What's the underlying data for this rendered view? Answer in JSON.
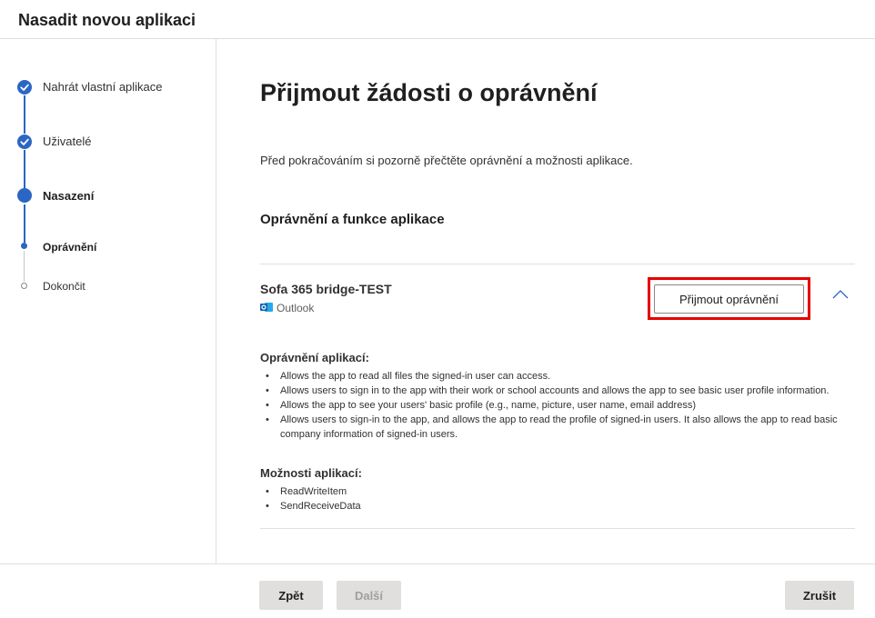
{
  "window": {
    "title": "Nasadit novou aplikaci"
  },
  "steps": [
    {
      "label": "Nahrát vlastní aplikace",
      "state": "done"
    },
    {
      "label": "Uživatelé",
      "state": "done"
    },
    {
      "label": "Nasazení",
      "state": "current"
    },
    {
      "label": "Oprávnění",
      "state": "current-sub"
    },
    {
      "label": "Dokončit",
      "state": "pending"
    }
  ],
  "main": {
    "title": "Přijmout žádosti o oprávnění",
    "intro": "Před pokračováním si pozorně přečtěte oprávnění a možnosti aplikace.",
    "section_title": "Oprávnění a funkce aplikace",
    "app": {
      "name": "Sofa 365 bridge-TEST",
      "host": "Outlook",
      "host_icon": "outlook-icon",
      "accept_label": "Přijmout oprávnění",
      "permissions_heading": "Oprávnění aplikací:",
      "permissions": [
        "Allows the app to read all files the signed-in user can access.",
        "Allows users to sign in to the app with their work or school accounts and allows the app to see basic user profile information.",
        "Allows the app to see your users' basic profile (e.g., name, picture, user name, email address)",
        "Allows users to sign-in to the app, and allows the app to read the profile of signed-in users. It also allows the app to read basic company information of signed-in users."
      ],
      "capabilities_heading": "Možnosti aplikací:",
      "capabilities": [
        "ReadWriteItem",
        "SendReceiveData"
      ]
    }
  },
  "footer": {
    "back_label": "Zpět",
    "next_label": "Další",
    "cancel_label": "Zrušit"
  },
  "colors": {
    "accent": "#2b66c4",
    "highlight": "#e50000"
  }
}
